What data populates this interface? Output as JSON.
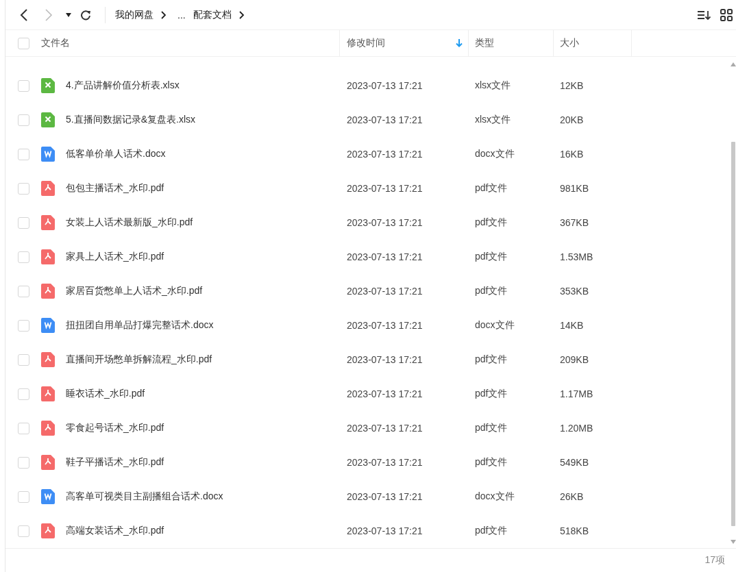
{
  "breadcrumb": [
    {
      "label": "我的网盘"
    },
    {
      "label": "..."
    },
    {
      "label": "配套文档"
    }
  ],
  "columns": [
    {
      "label": "文件名",
      "sorted": false
    },
    {
      "label": "修改时间",
      "sorted": true
    },
    {
      "label": "类型",
      "sorted": false
    },
    {
      "label": "大小",
      "sorted": false
    }
  ],
  "select_all": {
    "checked": false
  },
  "files": [
    {
      "kind": "xlsx",
      "name": "4.产品讲解价值分析表.xlsx",
      "modified": "2023-07-13 17:21",
      "type": "xlsx文件",
      "size": "12KB",
      "checked": false
    },
    {
      "kind": "xlsx",
      "name": "5.直播间数据记录&复盘表.xlsx",
      "modified": "2023-07-13 17:21",
      "type": "xlsx文件",
      "size": "20KB",
      "checked": false
    },
    {
      "kind": "docx",
      "name": "低客单价单人话术.docx",
      "modified": "2023-07-13 17:21",
      "type": "docx文件",
      "size": "16KB",
      "checked": false
    },
    {
      "kind": "pdf",
      "name": "包包主播话术_水印.pdf",
      "modified": "2023-07-13 17:21",
      "type": "pdf文件",
      "size": "981KB",
      "checked": false
    },
    {
      "kind": "pdf",
      "name": "女装上人话术最新版_水印.pdf",
      "modified": "2023-07-13 17:21",
      "type": "pdf文件",
      "size": "367KB",
      "checked": false
    },
    {
      "kind": "pdf",
      "name": "家具上人话术_水印.pdf",
      "modified": "2023-07-13 17:21",
      "type": "pdf文件",
      "size": "1.53MB",
      "checked": false
    },
    {
      "kind": "pdf",
      "name": "家居百货憋单上人话术_水印.pdf",
      "modified": "2023-07-13 17:21",
      "type": "pdf文件",
      "size": "353KB",
      "checked": false
    },
    {
      "kind": "docx",
      "name": "扭扭团自用单品打爆完整话术.docx",
      "modified": "2023-07-13 17:21",
      "type": "docx文件",
      "size": "14KB",
      "checked": false
    },
    {
      "kind": "pdf",
      "name": "直播间开场憋单拆解流程_水印.pdf",
      "modified": "2023-07-13 17:21",
      "type": "pdf文件",
      "size": "209KB",
      "checked": false
    },
    {
      "kind": "pdf",
      "name": "睡衣话术_水印.pdf",
      "modified": "2023-07-13 17:21",
      "type": "pdf文件",
      "size": "1.17MB",
      "checked": false
    },
    {
      "kind": "pdf",
      "name": "零食起号话术_水印.pdf",
      "modified": "2023-07-13 17:21",
      "type": "pdf文件",
      "size": "1.20MB",
      "checked": false
    },
    {
      "kind": "pdf",
      "name": "鞋子平播话术_水印.pdf",
      "modified": "2023-07-13 17:21",
      "type": "pdf文件",
      "size": "549KB",
      "checked": false
    },
    {
      "kind": "docx",
      "name": "高客单可视类目主副播组合话术.docx",
      "modified": "2023-07-13 17:21",
      "type": "docx文件",
      "size": "26KB",
      "checked": false
    },
    {
      "kind": "pdf",
      "name": "高端女装话术_水印.pdf",
      "modified": "2023-07-13 17:21",
      "type": "pdf文件",
      "size": "518KB",
      "checked": false
    }
  ],
  "status_bar": {
    "count": "17项"
  }
}
